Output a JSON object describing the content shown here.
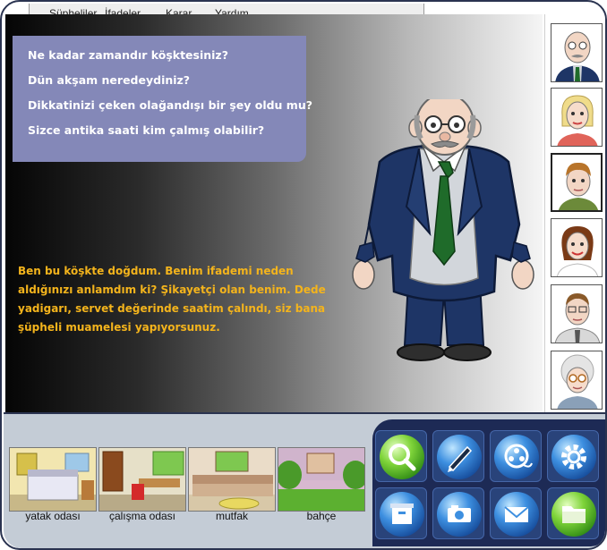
{
  "menu": {
    "items": [
      "Şüpheliler",
      "İfadeler",
      "Karar",
      "Yardım"
    ]
  },
  "questions": [
    "Ne kadar zamandır köşktesiniz?",
    "Dün akşam neredeydiniz?",
    "Dikkatinizi çeken olağandışı bir şey oldu mu?",
    "Sizce antika saati kim çalmış olabilir?"
  ],
  "statement": "Ben bu köşkte doğdum. Benim ifademi neden aldığınızı anlamdım ki? Şikayetçi olan benim. Dede yadigarı, servet değerinde saatim çalındı, siz bana şüpheli muamelesi yapıyorsunuz.",
  "suspects": [
    {
      "icon": "bald-man-suit-portrait",
      "active": false
    },
    {
      "icon": "blonde-woman-portrait",
      "active": false
    },
    {
      "icon": "young-man-portrait",
      "active": true
    },
    {
      "icon": "brunette-woman-portrait",
      "active": false
    },
    {
      "icon": "man-glasses-portrait",
      "active": false
    },
    {
      "icon": "old-woman-glasses-portrait",
      "active": false
    }
  ],
  "rooms": [
    {
      "label": "yatak odası"
    },
    {
      "label": "çalışma odası"
    },
    {
      "label": "mutfak"
    },
    {
      "label": "bahçe"
    }
  ],
  "tools": [
    {
      "icon": "magnifier-icon"
    },
    {
      "icon": "pen-icon"
    },
    {
      "icon": "film-reel-icon"
    },
    {
      "icon": "gear-icon"
    },
    {
      "icon": "archive-box-icon"
    },
    {
      "icon": "camera-icon"
    },
    {
      "icon": "envelope-icon"
    },
    {
      "icon": "folder-icon"
    }
  ],
  "colors": {
    "question_panel": "#8488b8",
    "statement_text": "#f4b41c",
    "tools_panel": "#1d2a55",
    "bottom_panel": "#c4ccd6"
  }
}
